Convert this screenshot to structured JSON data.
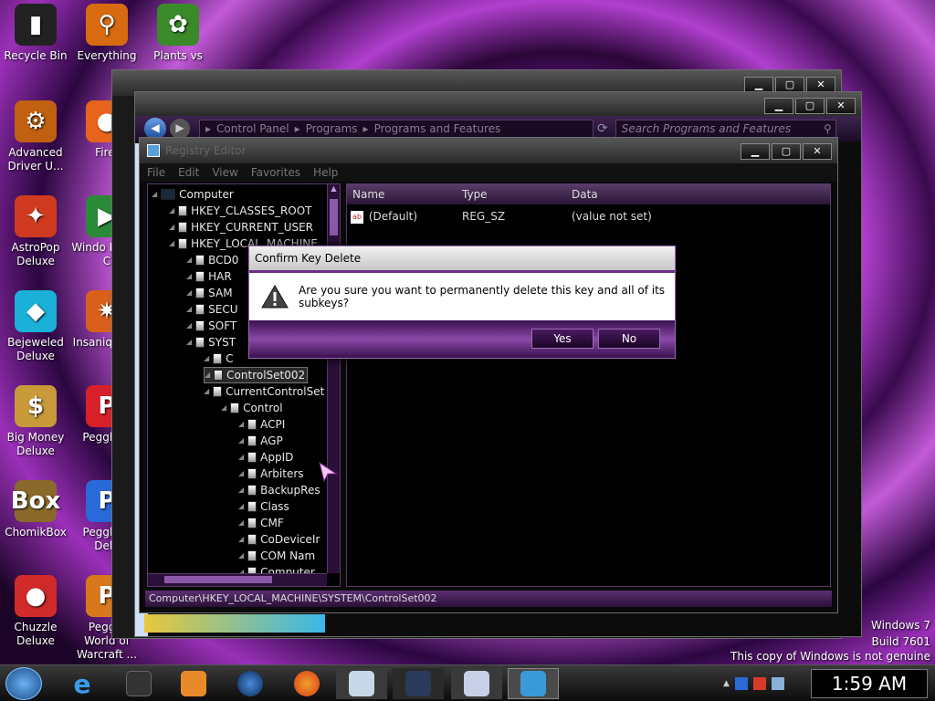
{
  "desktop": {
    "icons": [
      {
        "label": "Recycle Bin",
        "glyph": "▮",
        "color": "#222"
      },
      {
        "label": "Everything",
        "glyph": "⚲",
        "color": "#d86a10"
      },
      {
        "label": "Plants vs",
        "glyph": "✿",
        "color": "#3a8a2a"
      },
      {
        "label": "Advanced Driver U...",
        "glyph": "⚙",
        "color": "#c06010"
      },
      {
        "label": "Firef",
        "glyph": "●",
        "color": "#e8641a"
      },
      {
        "label": "AstroPop Deluxe",
        "glyph": "✦",
        "color": "#d03a20"
      },
      {
        "label": "Windo Media C",
        "glyph": "▶",
        "color": "#2a8a3a"
      },
      {
        "label": "Bejeweled Deluxe",
        "glyph": "◆",
        "color": "#1ab0d8"
      },
      {
        "label": "Insaniq Delu",
        "glyph": "✷",
        "color": "#d8601a"
      },
      {
        "label": "Big Money Deluxe",
        "glyph": "$",
        "color": "#c89a3a"
      },
      {
        "label": "Peggle D",
        "glyph": "P",
        "color": "#d8202a"
      },
      {
        "label": "ChomikBox",
        "glyph": "Box",
        "color": "#8a6a2a"
      },
      {
        "label": "Peggle N Delu",
        "glyph": "P",
        "color": "#2a6ad8"
      },
      {
        "label": "Chuzzle Deluxe",
        "glyph": "●",
        "color": "#d02a2a"
      },
      {
        "label": "Peggle World of Warcraft ...",
        "glyph": "P",
        "color": "#d8781a"
      }
    ]
  },
  "explorer": {
    "breadcrumb": [
      "Control Panel",
      "Programs",
      "Programs and Features"
    ],
    "search_placeholder": "Search Programs and Features"
  },
  "regedit": {
    "title": "Registry Editor",
    "menu": [
      "File",
      "Edit",
      "View",
      "Favorites",
      "Help"
    ],
    "tree": [
      {
        "label": "Computer",
        "level": 0
      },
      {
        "label": "HKEY_CLASSES_ROOT",
        "level": 1
      },
      {
        "label": "HKEY_CURRENT_USER",
        "level": 1
      },
      {
        "label": "HKEY_LOCAL_MACHINE",
        "level": 1
      },
      {
        "label": "BCD0",
        "level": 2
      },
      {
        "label": "HAR",
        "level": 2
      },
      {
        "label": "SAM",
        "level": 2
      },
      {
        "label": "SECU",
        "level": 2
      },
      {
        "label": "SOFT",
        "level": 2
      },
      {
        "label": "SYST",
        "level": 2
      },
      {
        "label": "C",
        "level": 3
      },
      {
        "label": "ControlSet002",
        "level": 3
      },
      {
        "label": "CurrentControlSet",
        "level": 3
      },
      {
        "label": "Control",
        "level": 4
      },
      {
        "label": "ACPI",
        "level": 5
      },
      {
        "label": "AGP",
        "level": 5
      },
      {
        "label": "AppID",
        "level": 5
      },
      {
        "label": "Arbiters",
        "level": 5
      },
      {
        "label": "BackupRes",
        "level": 5
      },
      {
        "label": "Class",
        "level": 5
      },
      {
        "label": "CMF",
        "level": 5
      },
      {
        "label": "CoDeviceIr",
        "level": 5
      },
      {
        "label": "COM Nam",
        "level": 5
      },
      {
        "label": "Computer",
        "level": 5
      }
    ],
    "columns": [
      "Name",
      "Type",
      "Data"
    ],
    "values": [
      {
        "name": "(Default)",
        "type": "REG_SZ",
        "data": "(value not set)"
      }
    ],
    "status": "Computer\\HKEY_LOCAL_MACHINE\\SYSTEM\\ControlSet002"
  },
  "dialog": {
    "title": "Confirm Key Delete",
    "message": "Are you sure you want to permanently delete this key and all of its subkeys?",
    "yes": "Yes",
    "no": "No"
  },
  "taskbar": {
    "clock": "1:59 AM"
  },
  "watermark": {
    "line1": "Windows 7",
    "line2": "Build 7601",
    "line3": "This copy of Windows is not genuine"
  }
}
